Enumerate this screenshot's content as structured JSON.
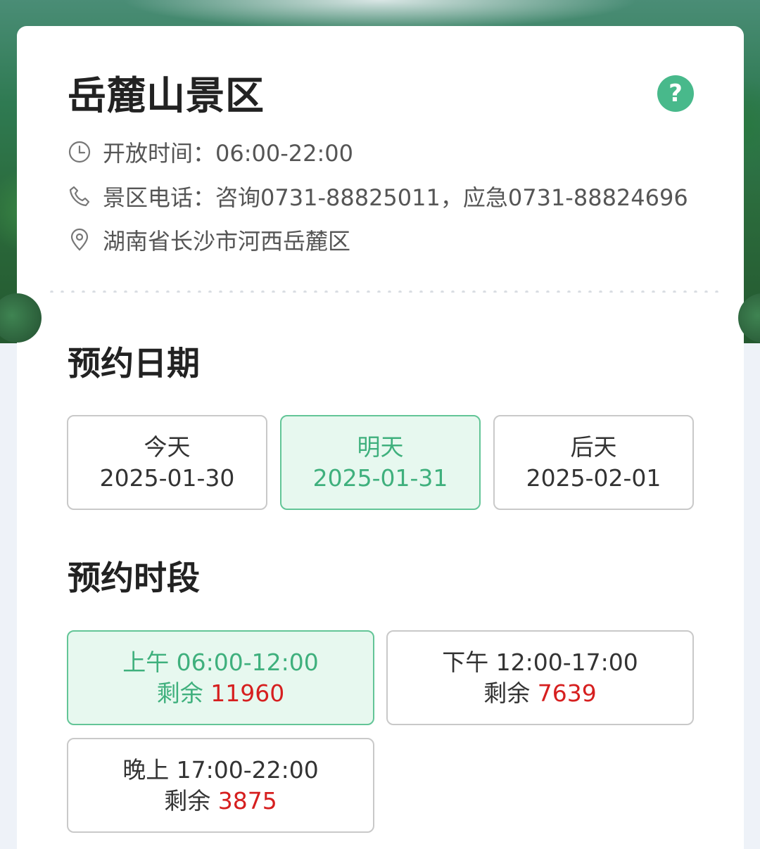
{
  "scenic": {
    "title": "岳麓山景区",
    "help_icon": "question-icon",
    "help_symbol": "?",
    "hours": "开放时间：06:00-22:00",
    "phone": "景区电话：咨询0731-88825011，应急0731-88824696",
    "address": "湖南省长沙市河西岳麓区"
  },
  "icons": {
    "hours": "clock-icon",
    "phone": "phone-icon",
    "address": "location-pin-icon"
  },
  "date_section": {
    "title": "预约日期",
    "options": [
      {
        "label": "今天",
        "date": "2025-01-30",
        "selected": false
      },
      {
        "label": "明天",
        "date": "2025-01-31",
        "selected": true
      },
      {
        "label": "后天",
        "date": "2025-02-01",
        "selected": false
      }
    ]
  },
  "time_section": {
    "title": "预约时段",
    "remain_label": "剩余",
    "slots": [
      {
        "period": "上午 06:00-12:00",
        "remaining": "11960",
        "selected": true
      },
      {
        "period": "下午 12:00-17:00",
        "remaining": "7639",
        "selected": false
      },
      {
        "period": "晚上 17:00-22:00",
        "remaining": "3875",
        "selected": false
      }
    ]
  },
  "colors": {
    "accent": "#48b98b",
    "selected_bg": "#e7f8ef",
    "remaining": "#d61f1f"
  }
}
